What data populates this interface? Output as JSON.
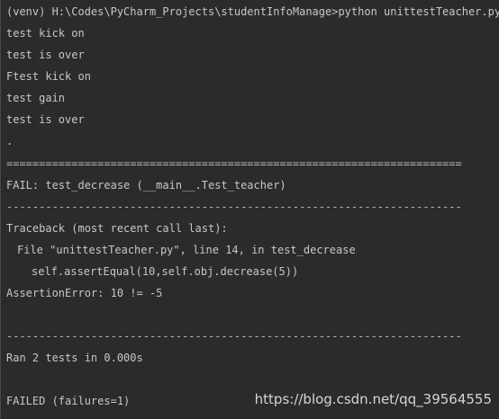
{
  "terminal": {
    "prompt_line": "(venv) H:\\Codes\\PyCharm_Projects\\studentInfoManage>python unittestTeacher.py",
    "lines": [
      "test kick on",
      "test is over",
      "Ftest kick on",
      "test gain",
      "test is over",
      ".",
      "======================================================================",
      "FAIL: test_decrease (__main__.Test_teacher)",
      "----------------------------------------------------------------------",
      "Traceback (most recent call last):",
      "File \"unittestTeacher.py\", line 14, in test_decrease",
      "self.assertEqual(10,self.obj.decrease(5))",
      "AssertionError: 10 != -5",
      "----------------------------------------------------------------------",
      "Ran 2 tests in 0.000s",
      "FAILED (failures=1)"
    ]
  },
  "watermark": "https://blog.csdn.net/qq_39564555"
}
